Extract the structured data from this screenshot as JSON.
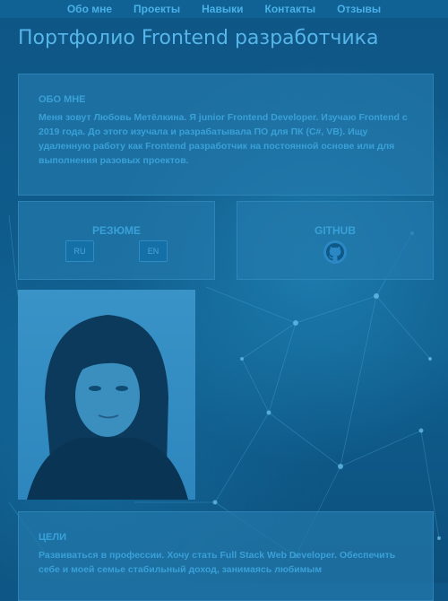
{
  "nav": {
    "items": [
      "Обо мне",
      "Проекты",
      "Навыки",
      "Контакты",
      "Отзывы"
    ]
  },
  "page": {
    "title": "Портфолио Frontend разработчика"
  },
  "about": {
    "heading": "ОБО МНЕ",
    "text": "Меня зовут Любовь Метёлкина. Я junior Frontend Developer. Изучаю Frontend с 2019 года. До этого изучала и разрабатывала ПО для ПК (C#, VB). Ищу удаленную работу как Frontend разработчик на постоянной основе или для выполнения разовых проектов."
  },
  "resume": {
    "heading": "РЕЗЮМЕ",
    "btn_ru": "RU",
    "btn_en": "EN"
  },
  "github": {
    "heading": "GITHUB",
    "icon": "github-icon"
  },
  "goals": {
    "heading": "ЦЕЛИ",
    "text": "Развиваться в профессии. Хочу стать Full Stack Web Developer. Обеспечить себе и моей семье стабильный доход, занимаясь любимым"
  },
  "colors": {
    "background": "#0f5f8f",
    "accent": "#56b6ea",
    "card": "#2378aa"
  }
}
